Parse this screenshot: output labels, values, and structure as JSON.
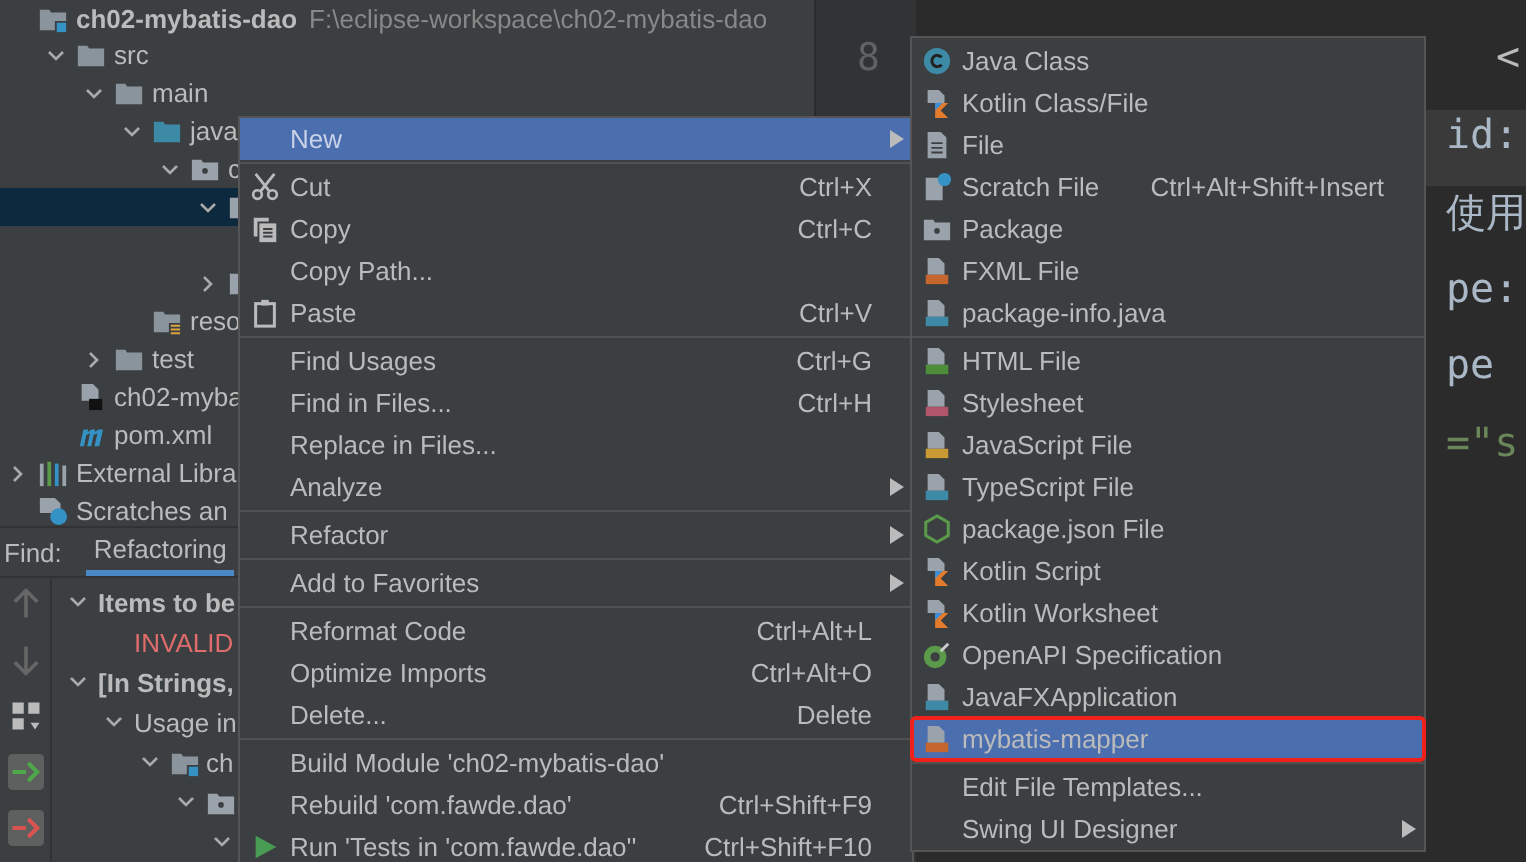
{
  "project_tree": {
    "header": {
      "name": "ch02-mybatis-dao",
      "path": "F:\\eclipse-workspace\\ch02-mybatis-dao"
    },
    "items": [
      {
        "label": "src",
        "kind": "folder",
        "expanded": true,
        "selected": false,
        "children": [
          {
            "label": "main",
            "kind": "folder",
            "expanded": true,
            "selected": false,
            "children": [
              {
                "label": "java",
                "kind": "source-folder",
                "expanded": true,
                "selected": false,
                "children": [
                  {
                    "label": "c",
                    "kind": "package",
                    "expanded": true,
                    "selected": false,
                    "children": [
                      {
                        "kind": "package",
                        "expanded": true,
                        "selected": true,
                        "children": [
                          {
                            "selected": false
                          }
                        ]
                      },
                      {
                        "kind": "package",
                        "expanded": false,
                        "selected": false
                      }
                    ]
                  }
                ]
              },
              {
                "label": "reso",
                "kind": "resources",
                "selected": false
              }
            ]
          },
          {
            "label": "test",
            "kind": "folder",
            "expanded": false,
            "selected": false
          }
        ]
      },
      {
        "label": "ch02-myba",
        "kind": "module-file",
        "selected": false
      },
      {
        "label": "pom.xml",
        "kind": "maven",
        "selected": false
      }
    ]
  },
  "root_items": [
    {
      "label": "External Libra",
      "kind": "libraries",
      "expanded": false,
      "selected": false
    },
    {
      "label": "Scratches an",
      "kind": "scratches",
      "selected": false
    }
  ],
  "find_panel": {
    "label": "Find:",
    "tabs": [
      {
        "label": "Refactoring",
        "selected": true
      }
    ],
    "items": [
      {
        "kind": "heading",
        "label": "Items to be",
        "expanded": true,
        "children": [
          {
            "kind": "error",
            "label": "INVALID"
          }
        ]
      },
      {
        "kind": "heading",
        "label": "[In Strings,",
        "expanded": true,
        "children": [
          {
            "kind": "plain",
            "label": "Usage in",
            "expanded": true,
            "children": [
              {
                "kind": "module",
                "label": "ch",
                "expanded": true,
                "children": [
                  {
                    "kind": "package",
                    "expanded": true,
                    "children": [
                      {
                        "expanded": true
                      }
                    ]
                  }
                ]
              }
            ]
          }
        ]
      }
    ]
  },
  "editor": {
    "line_number": "8",
    "lines": [
      {
        "kind": "tag",
        "text": "<",
        "current": false
      },
      {
        "kind": "text",
        "text": "id:",
        "current": true
      },
      {
        "kind": "text",
        "text": "使用",
        "current": false
      },
      {
        "kind": "text",
        "text": "pe:",
        "current": false
      },
      {
        "kind": "text",
        "text": "pe",
        "current": false
      },
      {
        "kind": "string",
        "text": "=\"s",
        "current": false
      }
    ]
  },
  "context_menu": {
    "groups": [
      [
        {
          "label": "New",
          "selected": true,
          "submenu": true
        }
      ],
      [
        {
          "label": "Cut",
          "shortcut": "Ctrl+X",
          "kind": "cut",
          "selected": false,
          "submenu": false
        },
        {
          "label": "Copy",
          "shortcut": "Ctrl+C",
          "kind": "copy",
          "selected": false,
          "submenu": false
        },
        {
          "label": "Copy Path...",
          "selected": false,
          "submenu": false
        },
        {
          "label": "Paste",
          "shortcut": "Ctrl+V",
          "kind": "paste",
          "selected": false,
          "submenu": false
        }
      ],
      [
        {
          "label": "Find Usages",
          "shortcut": "Ctrl+G",
          "selected": false,
          "submenu": false
        },
        {
          "label": "Find in Files...",
          "shortcut": "Ctrl+H",
          "selected": false,
          "submenu": false
        },
        {
          "label": "Replace in Files...",
          "selected": false,
          "submenu": false
        },
        {
          "label": "Analyze",
          "selected": false,
          "submenu": true
        }
      ],
      [
        {
          "label": "Refactor",
          "selected": false,
          "submenu": true
        }
      ],
      [
        {
          "label": "Add to Favorites",
          "selected": false,
          "submenu": true
        }
      ],
      [
        {
          "label": "Reformat Code",
          "shortcut": "Ctrl+Alt+L",
          "selected": false,
          "submenu": false
        },
        {
          "label": "Optimize Imports",
          "shortcut": "Ctrl+Alt+O",
          "selected": false,
          "submenu": false
        },
        {
          "label": "Delete...",
          "shortcut": "Delete",
          "selected": false,
          "submenu": false
        }
      ],
      [
        {
          "label": "Build Module 'ch02-mybatis-dao'",
          "selected": false,
          "submenu": false
        },
        {
          "label": "Rebuild 'com.fawde.dao'",
          "shortcut": "Ctrl+Shift+F9",
          "selected": false,
          "submenu": false
        },
        {
          "label": "Run 'Tests in 'com.fawde.dao''",
          "shortcut": "Ctrl+Shift+F10",
          "kind": "run",
          "selected": false,
          "submenu": false
        }
      ]
    ]
  },
  "new_submenu": {
    "groups": [
      [
        {
          "label": "Java Class",
          "kind": "class",
          "selected": false,
          "outlined": false,
          "submenu": false
        },
        {
          "label": "Kotlin Class/File",
          "kind": "kotlin",
          "selected": false,
          "outlined": false,
          "submenu": false
        },
        {
          "label": "File",
          "kind": "file",
          "selected": false,
          "outlined": false,
          "submenu": false
        },
        {
          "label": "Scratch File",
          "shortcut": "Ctrl+Alt+Shift+Insert",
          "kind": "scratch",
          "selected": false,
          "outlined": false,
          "submenu": false
        },
        {
          "label": "Package",
          "kind": "package",
          "selected": false,
          "outlined": false,
          "submenu": false
        },
        {
          "label": "FXML File",
          "kind": "xml",
          "selected": false,
          "outlined": false,
          "submenu": false
        },
        {
          "label": "package-info.java",
          "kind": "java",
          "selected": false,
          "outlined": false,
          "submenu": false
        }
      ],
      [
        {
          "label": "HTML File",
          "kind": "html",
          "selected": false,
          "outlined": false,
          "submenu": false
        },
        {
          "label": "Stylesheet",
          "kind": "css",
          "selected": false,
          "outlined": false,
          "submenu": false
        },
        {
          "label": "JavaScript File",
          "kind": "js",
          "selected": false,
          "outlined": false,
          "submenu": false
        },
        {
          "label": "TypeScript File",
          "kind": "ts",
          "selected": false,
          "outlined": false,
          "submenu": false
        },
        {
          "label": "package.json File",
          "kind": "npm",
          "selected": false,
          "outlined": false,
          "submenu": false
        },
        {
          "label": "Kotlin Script",
          "kind": "kotlin",
          "selected": false,
          "outlined": false,
          "submenu": false
        },
        {
          "label": "Kotlin Worksheet",
          "kind": "kotlin",
          "selected": false,
          "outlined": false,
          "submenu": false
        },
        {
          "label": "OpenAPI Specification",
          "kind": "openapi",
          "selected": false,
          "outlined": false,
          "submenu": false
        },
        {
          "label": "JavaFXApplication",
          "kind": "java",
          "selected": false,
          "outlined": false,
          "submenu": false
        },
        {
          "label": "mybatis-mapper",
          "kind": "xml",
          "selected": true,
          "outlined": true,
          "submenu": false
        }
      ],
      [
        {
          "label": "Edit File Templates...",
          "selected": false,
          "outlined": false,
          "submenu": false
        },
        {
          "label": "Swing UI Designer",
          "selected": false,
          "outlined": false,
          "submenu": true
        }
      ]
    ]
  }
}
